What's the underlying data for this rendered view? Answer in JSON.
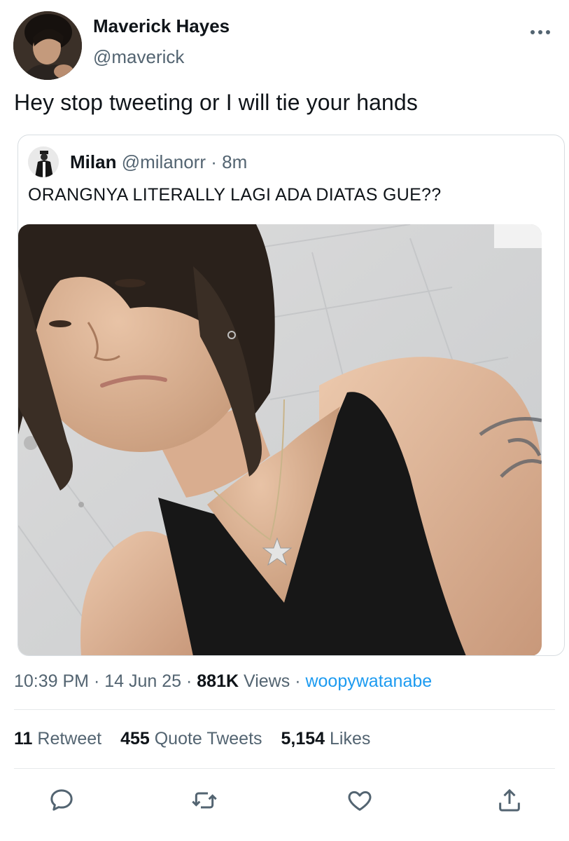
{
  "author": {
    "name": "Maverick Hayes",
    "handle": "@maverick",
    "avatar_icon": "profile-photo"
  },
  "tweet": {
    "text": "Hey stop tweeting or I will tie your hands"
  },
  "quoted": {
    "name": "Milan",
    "handle": "@milanorr",
    "separator": " · ",
    "time": "8m",
    "text": "ORANGNYA LITERALLY LAGI ADA DIATAS GUE??",
    "photo_icon": "selfie-photo"
  },
  "meta": {
    "time": "10:39 PM",
    "date": "14 Jun 25",
    "views_count": "881K",
    "views_label": "Views",
    "source": "woopywatanabe",
    "separator": " · "
  },
  "stats": {
    "retweets": {
      "count": "11",
      "label": "Retweet"
    },
    "quotes": {
      "count": "455",
      "label": "Quote Tweets"
    },
    "likes": {
      "count": "5,154",
      "label": "Likes"
    }
  },
  "actions": [
    {
      "name": "reply",
      "icon": "speech-bubble-icon"
    },
    {
      "name": "retweet",
      "icon": "retweet-arrows-icon"
    },
    {
      "name": "like",
      "icon": "heart-icon"
    },
    {
      "name": "share",
      "icon": "share-upload-icon"
    }
  ],
  "colors": {
    "text": "#0f1419",
    "secondary": "#536471",
    "link": "#1d9bf0",
    "border": "#d8dde1"
  }
}
